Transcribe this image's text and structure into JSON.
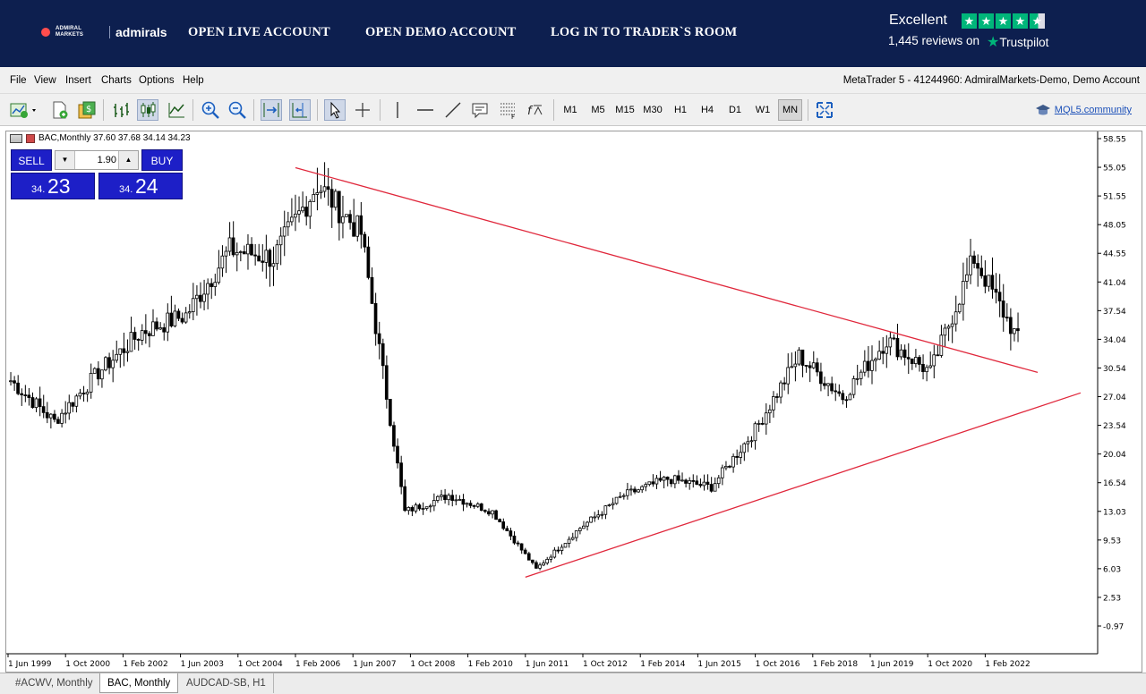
{
  "banner": {
    "logo_small": "ADMIRAL MARKETS",
    "logo_name": "admirals",
    "links": [
      "OPEN LIVE ACCOUNT",
      "OPEN DEMO ACCOUNT",
      "LOG IN TO TRADER`S ROOM"
    ],
    "trustpilot": {
      "rating_text": "Excellent",
      "reviews": "1,445 reviews on",
      "brand": "Trustpilot",
      "star_color": "#00b67a"
    }
  },
  "menu": {
    "items": [
      "File",
      "View",
      "Insert",
      "Charts",
      "Options",
      "Help"
    ],
    "window_title": "MetaTrader 5 - 41244960: AdmiralMarkets-Demo, Demo Account"
  },
  "toolbar": {
    "icons": [
      "new-chart-icon",
      "new-order-icon",
      "market-watch-icon",
      "bar-chart-icon",
      "candlestick-icon",
      "line-chart-icon",
      "zoom-in-icon",
      "zoom-out-icon",
      "auto-scroll-icon",
      "chart-shift-icon",
      "cursor-icon",
      "crosshair-icon",
      "vertical-line-icon",
      "horizontal-line-icon",
      "trend-line-icon",
      "text-label-icon",
      "fibonacci-icon",
      "indicators-icon",
      "fullscreen-icon"
    ],
    "timeframes": [
      "M1",
      "M5",
      "M15",
      "M30",
      "H1",
      "H4",
      "D1",
      "W1",
      "MN"
    ],
    "active_timeframe": "MN",
    "community_link": "MQL5.community"
  },
  "chart": {
    "info": "BAC,Monthly  37.60 37.68 34.14 34.23",
    "trade": {
      "sell_label": "SELL",
      "buy_label": "BUY",
      "lot": "1.90",
      "bid_small": "34.",
      "bid_big": "23",
      "ask_small": "34.",
      "ask_big": "24",
      "panel_color": "#1d1fc7"
    },
    "price_labels": [
      "58.55",
      "55.05",
      "51.55",
      "48.05",
      "44.55",
      "41.04",
      "37.54",
      "34.04",
      "30.54",
      "27.04",
      "23.54",
      "20.04",
      "16.54",
      "13.03",
      "9.53",
      "6.03",
      "2.53",
      "-0.97"
    ],
    "time_labels": [
      "1 Jun 1999",
      "1 Oct 2000",
      "1 Feb 2002",
      "1 Jun 2003",
      "1 Oct 2004",
      "1 Feb 2006",
      "1 Jun 2007",
      "1 Oct 2008",
      "1 Feb 2010",
      "1 Jun 2011",
      "1 Oct 2012",
      "1 Feb 2014",
      "1 Jun 2015",
      "1 Oct 2016",
      "1 Feb 2018",
      "1 Jun 2019",
      "1 Oct 2020",
      "1 Feb 2022"
    ],
    "trendline_color": "#e0283c"
  },
  "chart_data": {
    "type": "candlestick",
    "symbol": "BAC",
    "timeframe": "Monthly",
    "x": [
      "1999",
      "2000",
      "2001",
      "2002",
      "2003",
      "2004",
      "2005",
      "2006",
      "2007",
      "2008",
      "2009",
      "2010",
      "2011",
      "2012",
      "2013",
      "2014",
      "2015",
      "2016",
      "2017",
      "2018",
      "2019",
      "2020",
      "2021",
      "2022"
    ],
    "close": [
      29,
      24,
      30,
      35,
      37,
      45,
      44,
      53,
      47,
      13,
      15,
      13,
      6,
      11,
      15,
      17,
      16,
      23,
      32,
      27,
      34,
      30,
      44,
      34
    ],
    "ylim": [
      -0.97,
      58.55
    ],
    "trendlines": [
      {
        "from": [
          "1 Feb 2006",
          55.0
        ],
        "to": [
          "2022",
          30.0
        ]
      },
      {
        "from": [
          "1 Jun 2011",
          5.0
        ],
        "to": [
          "2022",
          27.5
        ]
      }
    ]
  }
}
